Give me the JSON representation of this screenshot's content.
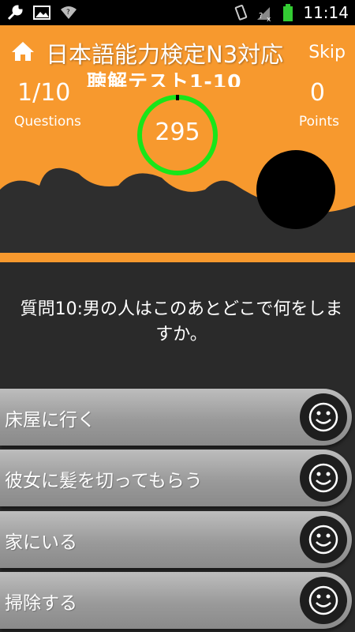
{
  "status_bar": {
    "time": "11:14",
    "icons": [
      "wrench-icon",
      "image-icon",
      "wifi-icon",
      "vibrate-icon",
      "no-signal-icon",
      "battery-icon"
    ]
  },
  "header": {
    "title": "日本語能力検定N3対応",
    "subtitle": "聴解テスト1-10",
    "skip_label": "Skip",
    "question_count": "1/10",
    "question_label": "Questions",
    "points": "0",
    "points_label": "Points",
    "timer": "295",
    "colors": {
      "background": "#f7992e",
      "timer_ring": "#19e619"
    }
  },
  "question": {
    "text": "質問10:男の人はこのあとどこで何をしますか。"
  },
  "answers": [
    {
      "label": "床屋に行く"
    },
    {
      "label": "彼女に髪を切ってもらう"
    },
    {
      "label": "家にいる"
    },
    {
      "label": "掃除する"
    }
  ]
}
